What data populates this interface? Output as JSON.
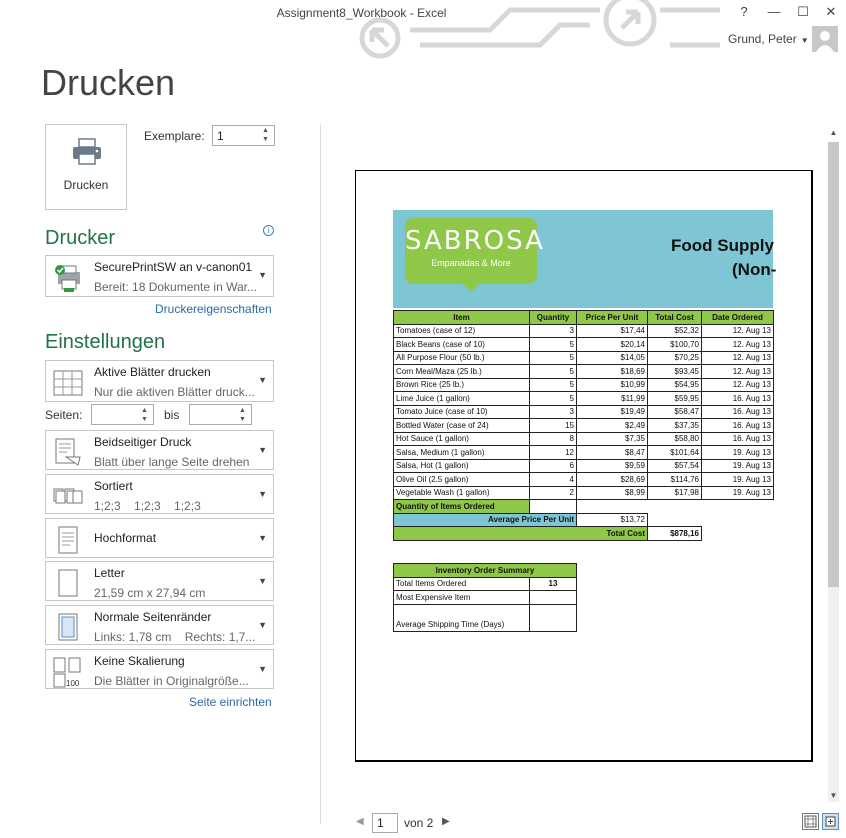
{
  "window": {
    "title": "Assignment8_Workbook - Excel",
    "help": "?",
    "minimize": "—",
    "maximize": "☐",
    "close": "✕",
    "user": "Grund, Peter"
  },
  "page_title": "Drucken",
  "print": {
    "button_label": "Drucken",
    "copies_label": "Exemplare:",
    "copies_value": "1"
  },
  "printer": {
    "section": "Drucker",
    "name": "SecurePrintSW an v-canon01",
    "status": "Bereit: 18 Dokumente in War...",
    "properties_link": "Druckereigenschaften"
  },
  "settings": {
    "section": "Einstellungen",
    "what": {
      "t1": "Aktive Blätter drucken",
      "t2": "Nur die aktiven Blätter druck..."
    },
    "pages_label": "Seiten:",
    "to_label": "bis",
    "duplex": {
      "t1": "Beidseitiger Druck",
      "t2": "Blatt über lange Seite drehen"
    },
    "collate": {
      "t1": "Sortiert",
      "t2": "1;2;3    1;2;3    1;2;3"
    },
    "orientation": {
      "t1": "Hochformat"
    },
    "paper": {
      "t1": "Letter",
      "t2": "21,59 cm x 27,94 cm"
    },
    "margins": {
      "t1": "Normale Seitenränder",
      "t2": "Links: 1,78 cm    Rechts: 1,7..."
    },
    "scaling": {
      "t1": "Keine Skalierung",
      "t2": "Die Blätter in Originalgröße..."
    },
    "page_setup_link": "Seite einrichten"
  },
  "preview": {
    "logo_name": "SABROSA",
    "logo_tag": "Empanadas & More",
    "header_line1": "Food Supply",
    "header_line2": "(Non-",
    "columns": [
      "Item",
      "Quantity",
      "Price Per Unit",
      "Total Cost",
      "Date Ordered"
    ],
    "rows": [
      [
        "Tomatoes (case of 12)",
        "3",
        "$17,44",
        "$52,32",
        "12. Aug 13"
      ],
      [
        "Black Beans (case of 10)",
        "5",
        "$20,14",
        "$100,70",
        "12. Aug 13"
      ],
      [
        "All Purpose Flour (50 lb.)",
        "5",
        "$14,05",
        "$70,25",
        "12. Aug 13"
      ],
      [
        "Corn Meal/Maza (25 lb.)",
        "5",
        "$18,69",
        "$93,45",
        "12. Aug 13"
      ],
      [
        "Brown Rice (25 lb.)",
        "5",
        "$10,99",
        "$54,95",
        "12. Aug 13"
      ],
      [
        "Lime Juice (1 gallon)",
        "5",
        "$11,99",
        "$59,95",
        "16. Aug 13"
      ],
      [
        "Tomato Juice (case of 10)",
        "3",
        "$19,49",
        "$58,47",
        "16. Aug 13"
      ],
      [
        "Bottled Water (case of 24)",
        "15",
        "$2,49",
        "$37,35",
        "16. Aug 13"
      ],
      [
        "Hot Sauce (1 gallon)",
        "8",
        "$7,35",
        "$58,80",
        "16. Aug 13"
      ],
      [
        "Salsa, Medium (1 gallon)",
        "12",
        "$8,47",
        "$101,64",
        "19. Aug 13"
      ],
      [
        "Salsa, Hot (1 gallon)",
        "6",
        "$9,59",
        "$57,54",
        "19. Aug 13"
      ],
      [
        "Olive Oil (2.5 gallon)",
        "4",
        "$28,69",
        "$114,76",
        "19. Aug 13"
      ],
      [
        "Vegetable Wash (1 gallon)",
        "2",
        "$8,99",
        "$17,98",
        "19. Aug 13"
      ]
    ],
    "qty_ordered_label": "Quantity of Items Ordered",
    "avg_price_label": "Average Price Per Unit",
    "avg_price_value": "$13,72",
    "total_cost_label": "Total Cost",
    "total_cost_value": "$878,16",
    "summary": {
      "title": "Inventory Order Summary",
      "rows": [
        [
          "Total Items Ordered",
          "13"
        ],
        [
          "Most Expensive Item",
          ""
        ],
        [
          "",
          ""
        ],
        [
          "Average Shipping Time (Days)",
          ""
        ]
      ]
    }
  },
  "nav": {
    "prev": "◀",
    "page": "1",
    "of": "von 2",
    "next": "▶"
  },
  "colors": {
    "accent_green": "#217346",
    "sheet_green": "#8fc749",
    "sheet_blue": "#7fc6d4",
    "link_blue": "#2a6aa8"
  }
}
